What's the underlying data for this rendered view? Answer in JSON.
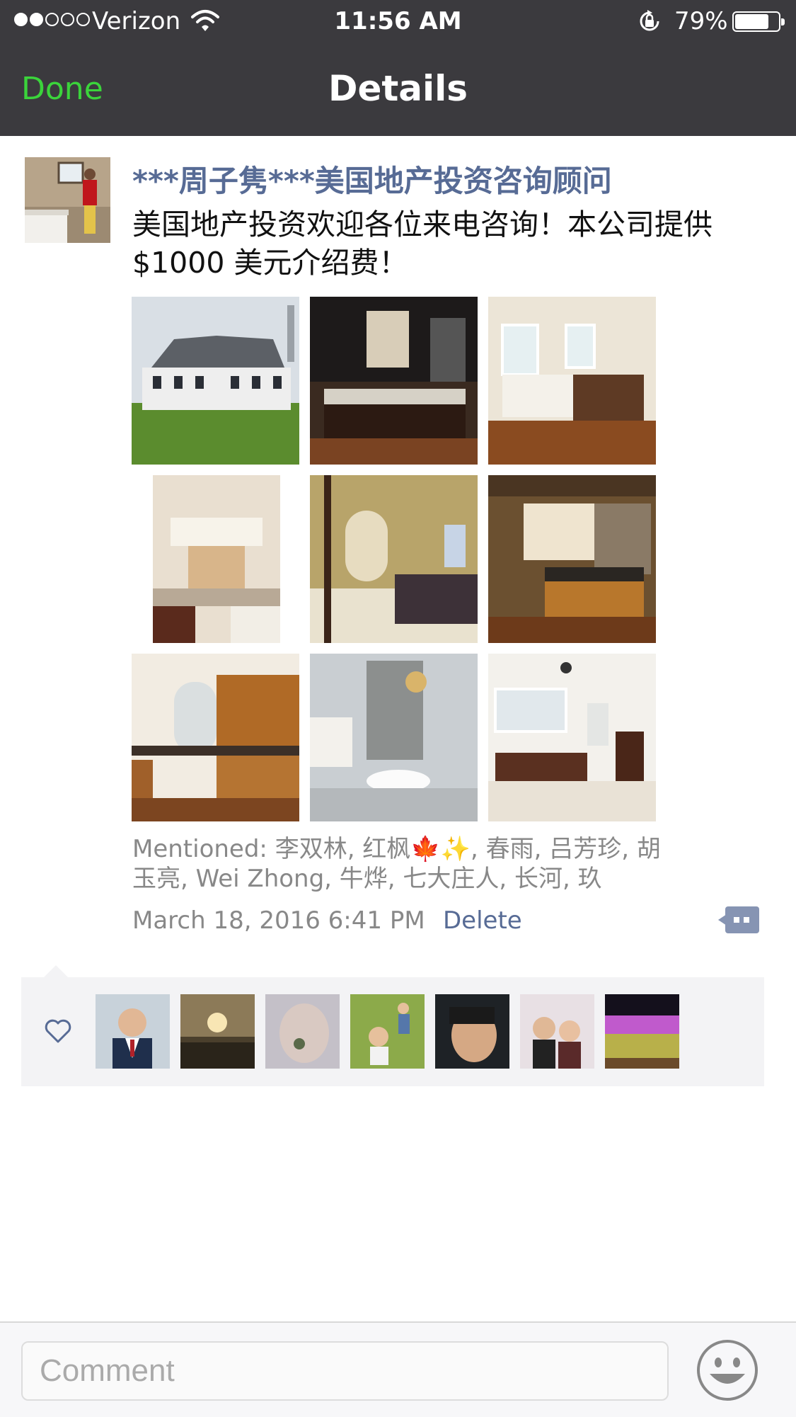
{
  "status_bar": {
    "carrier": "Verizon",
    "time": "11:56 AM",
    "battery_percent": "79%",
    "battery_level": 0.79,
    "signal_bars_filled": 2,
    "signal_bars_total": 5
  },
  "nav": {
    "done_label": "Done",
    "title": "Details"
  },
  "post": {
    "author": "***周子隽***美国地产投资咨询顾问",
    "text": "美国地产投资欢迎各位来电咨询！本公司提供$1000 美元介绍费！",
    "photos": [
      {
        "subject": "house exterior"
      },
      {
        "subject": "dark kitchen"
      },
      {
        "subject": "white kitchen"
      },
      {
        "subject": "kitchen range hood"
      },
      {
        "subject": "bedroom"
      },
      {
        "subject": "stone kitchen"
      },
      {
        "subject": "wood cabinets"
      },
      {
        "subject": "bathroom tub"
      },
      {
        "subject": "bright bathroom"
      }
    ],
    "mentioned": "Mentioned: 李双林, 红枫🍁✨, 春雨, 吕芳珍, 胡玉亮, Wei Zhong, 牛烨, 七大庄人, 长河, 玖",
    "timestamp": "March 18, 2016 6:41 PM",
    "delete_label": "Delete"
  },
  "likes": {
    "count": 7
  },
  "comment": {
    "placeholder": "Comment"
  },
  "colors": {
    "nav_background": "#3b3a3e",
    "done_green": "#3bd43b",
    "link_blue": "#576b95",
    "meta_gray": "#888888",
    "likes_background": "#f3f3f5"
  }
}
